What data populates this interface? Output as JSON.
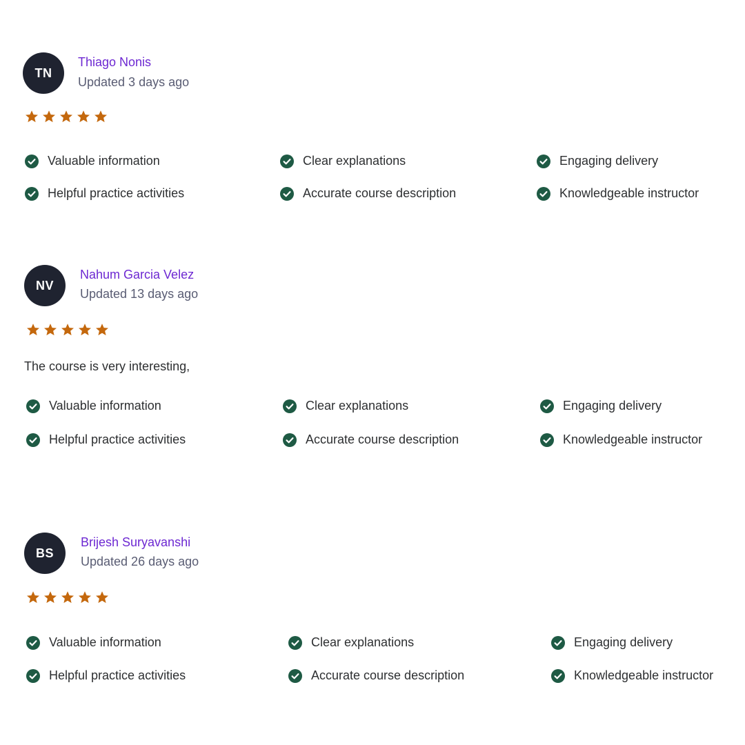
{
  "colors": {
    "name": "#6d28d2",
    "avatar_bg": "#1f2330",
    "star": "#c4680d",
    "check": "#1e5a44",
    "text": "#2d2f31",
    "muted": "#595c73"
  },
  "icons": {
    "star": "star-icon",
    "check": "check-circle-icon"
  },
  "reviews": [
    {
      "initials": "TN",
      "name": "Thiago Nonis",
      "updated": "Updated 3 days ago",
      "rating": 5,
      "comment": "",
      "tags": [
        "Valuable information",
        "Clear explanations",
        "Engaging delivery",
        "Helpful practice activities",
        "Accurate course description",
        "Knowledgeable instructor"
      ]
    },
    {
      "initials": "NV",
      "name": "Nahum Garcia Velez",
      "updated": "Updated 13 days ago",
      "rating": 5,
      "comment": "The course is very interesting,",
      "tags": [
        "Valuable information",
        "Clear explanations",
        "Engaging delivery",
        "Helpful practice activities",
        "Accurate course description",
        "Knowledgeable instructor"
      ]
    },
    {
      "initials": "BS",
      "name": "Brijesh Suryavanshi",
      "updated": "Updated 26 days ago",
      "rating": 5,
      "comment": "",
      "tags": [
        "Valuable information",
        "Clear explanations",
        "Engaging delivery",
        "Helpful practice activities",
        "Accurate course description",
        "Knowledgeable instructor"
      ]
    }
  ]
}
